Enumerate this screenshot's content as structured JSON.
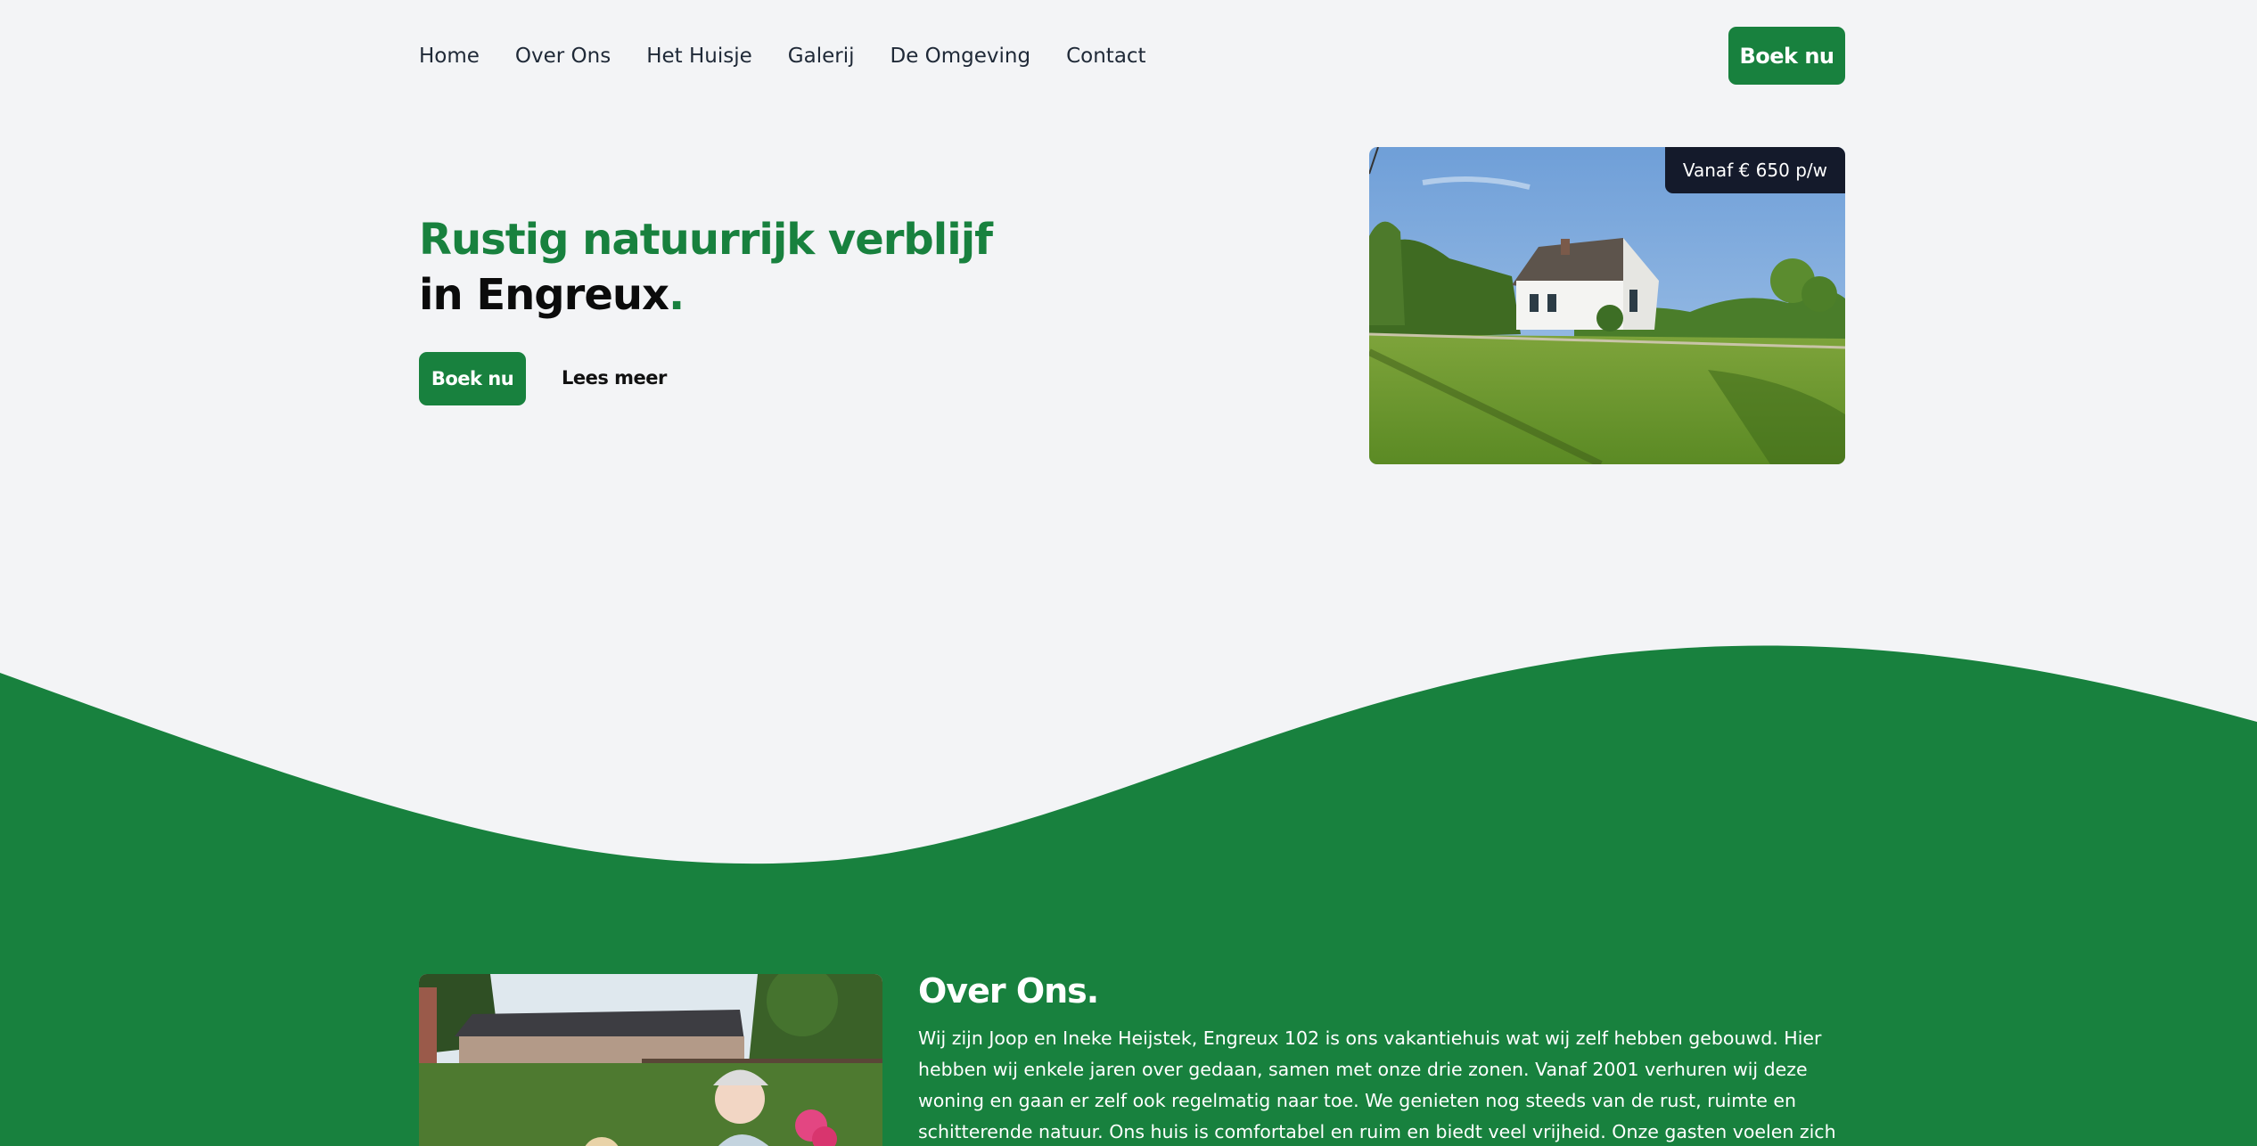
{
  "nav": {
    "links": [
      "Home",
      "Over Ons",
      "Het Huisje",
      "Galerij",
      "De Omgeving",
      "Contact"
    ],
    "cta": "Boek nu"
  },
  "hero": {
    "title_line1": "Rustig natuurrijk verblijf",
    "title_line2": "in Engreux",
    "title_dot": ".",
    "primary_button": "Boek nu",
    "secondary_link": "Lees meer",
    "price_badge": "Vanaf € 650 p/w"
  },
  "about": {
    "title": "Over Ons.",
    "text": "Wij zijn Joop en Ineke Heijstek, Engreux 102 is ons vakantiehuis wat wij zelf hebben gebouwd. Hier hebben wij enkele jaren over gedaan, samen met onze drie zonen. Vanaf 2001 verhuren wij deze woning en gaan er zelf ook regelmatig naar toe. We genieten nog steeds van de rust, ruimte en schitterende natuur. Ons huis is comfortabel en ruim en biedt veel vrijheid. Onze gasten voelen zich er meestal al snel"
  },
  "colors": {
    "brand_green": "#18813e",
    "background": "#f3f4f6",
    "badge_dark": "#141a2b"
  }
}
